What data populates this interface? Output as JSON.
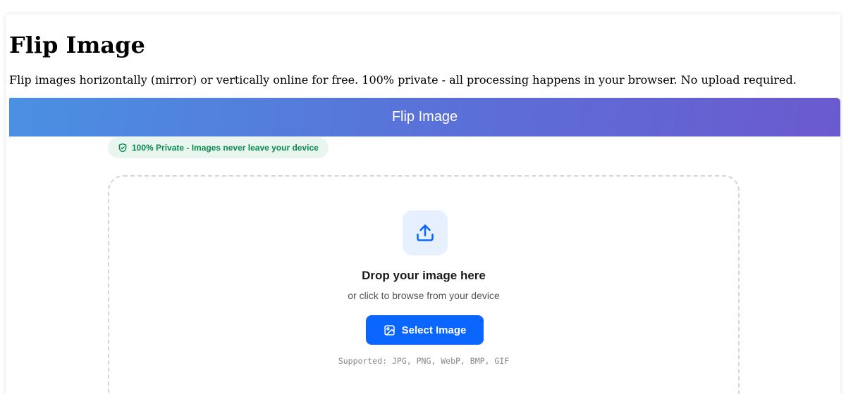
{
  "page": {
    "title": "Flip Image",
    "description": "Flip images horizontally (mirror) or vertically online for free. 100% private - all processing happens in your browser. No upload required."
  },
  "tool": {
    "header_title": "Flip Image",
    "privacy_badge": "100% Private - Images never leave your device",
    "privacy_icon": "shield-check-icon"
  },
  "dropzone": {
    "icon": "upload-icon",
    "title": "Drop your image here",
    "subtitle": "or click to browse from your device",
    "button_label": "Select Image",
    "button_icon": "image-icon",
    "supported": "Supported: JPG, PNG, WebP, BMP, GIF"
  },
  "colors": {
    "header_gradient_start": "#4a90e2",
    "header_gradient_end": "#6b5acf",
    "accent": "#0a66ff",
    "privacy_green": "#0a8a4e"
  }
}
